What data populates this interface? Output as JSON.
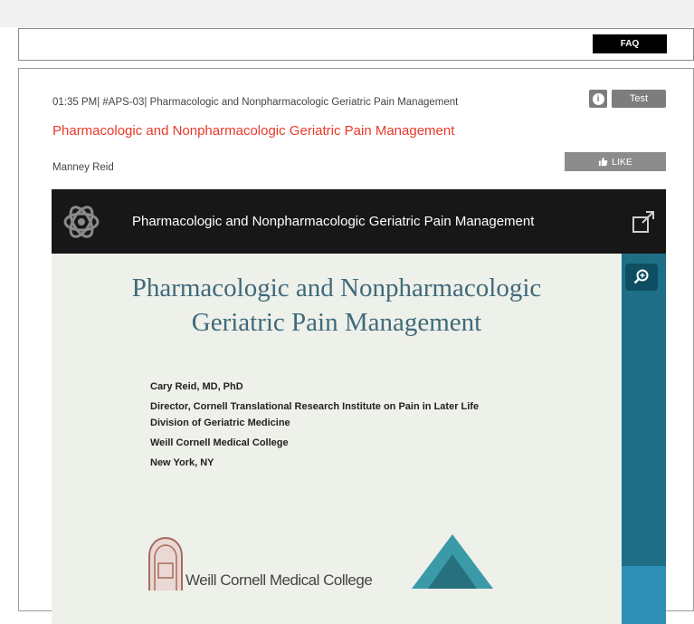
{
  "faq_label": "FAQ",
  "session": {
    "header": "01:35 PM| #APS-03| Pharmacologic and Nonpharmacologic Geriatric Pain Management",
    "info_icon": "info-icon",
    "test_label": "Test",
    "title": "Pharmacologic and Nonpharmacologic Geriatric Pain Management",
    "author": "Manney Reid",
    "like_label": "LIKE",
    "like_icon": "thumbs-up-icon"
  },
  "video": {
    "title": "Pharmacologic and Nonpharmacologic Geriatric Pain Management",
    "logo_icon": "presentation-logo-icon",
    "external_icon": "open-external-icon",
    "zoom_icon": "zoom-in-icon",
    "slide": {
      "heading_line1": "Pharmacologic and Nonpharmacologic",
      "heading_line2": "Geriatric Pain Management",
      "lines": [
        "Cary Reid, MD, PhD",
        "Director, Cornell Translational Research Institute on Pain in Later Life",
        "Division of Geriatric Medicine",
        "Weill Cornell Medical College",
        "New York, NY"
      ],
      "footer_text": "Weill Cornell Medical College"
    }
  },
  "colors": {
    "title_red": "#e8392a",
    "slide_heading": "#3f6a7a",
    "sidebar_teal": "#1e6f86"
  }
}
